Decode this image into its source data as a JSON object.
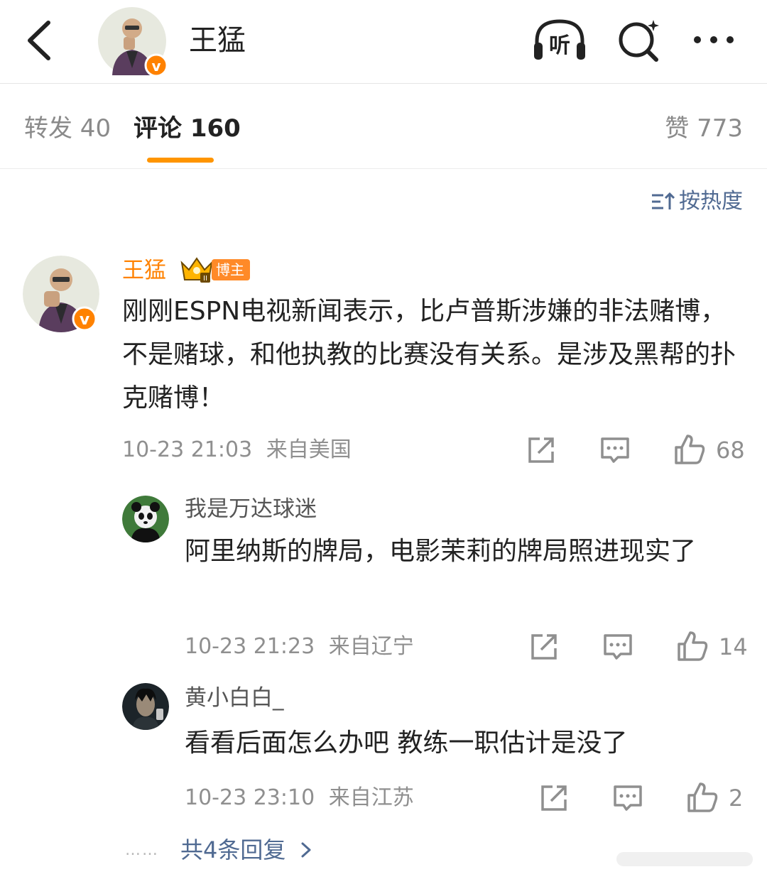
{
  "header": {
    "title": "王猛",
    "listen_icon": "headphones-listen-icon",
    "listen_label": "听",
    "search_icon": "search-icon",
    "more_icon": "more-icon"
  },
  "tabs": [
    {
      "label": "转发 40"
    },
    {
      "label": "评论 160"
    },
    {
      "label": "赞 773"
    }
  ],
  "sort": {
    "label": "按热度",
    "icon": "sort-icon"
  },
  "accent_color": "#ff9500",
  "link_color": "#506a92",
  "main_comment": {
    "author": "王猛",
    "badge_label": "博主",
    "text": "刚刚ESPN电视新闻表示，比卢普斯涉嫌的非法赌博，不是赌球，和他执教的比赛没有关系。是涉及黑帮的扑克赌博！",
    "time": "10-23 21:03",
    "location": "来自美国",
    "likes": "68"
  },
  "replies": [
    {
      "author": "我是万达球迷",
      "text": "阿里纳斯的牌局，电影茉莉的牌局照进现实了",
      "time": "10-23 21:23",
      "location": "来自辽宁",
      "likes": "14"
    },
    {
      "author": "黄小白白_",
      "text": "看看后面怎么办吧 教练一职估计是没了",
      "time": "10-23 23:10",
      "location": "来自江苏",
      "likes": "2"
    }
  ],
  "more_replies": {
    "label": "共4条回复",
    "dots": "……"
  }
}
